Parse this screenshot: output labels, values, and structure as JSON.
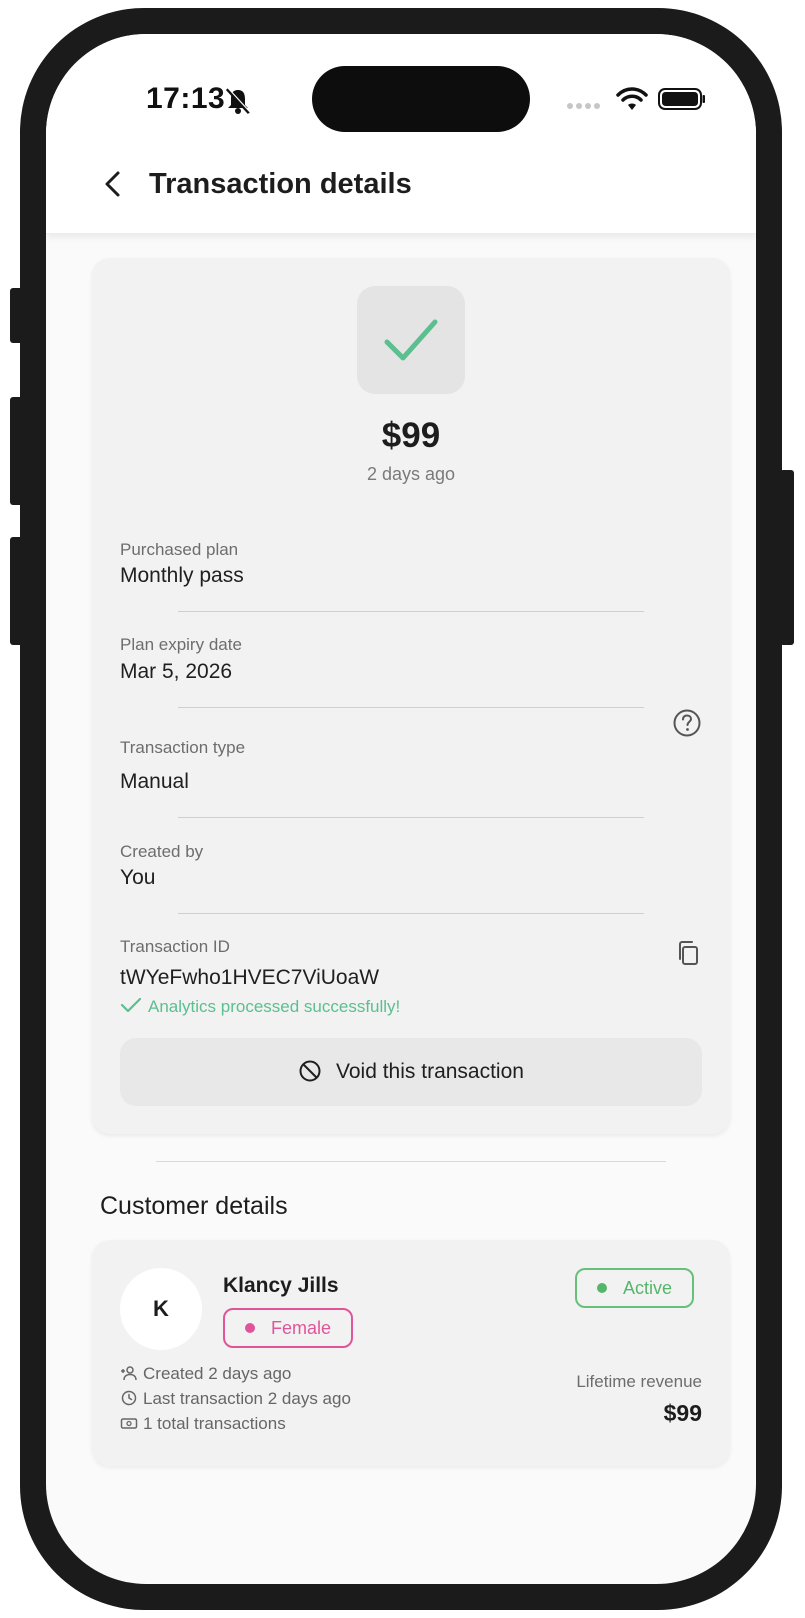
{
  "status_bar": {
    "time": "17:13"
  },
  "header": {
    "title": "Transaction details"
  },
  "transaction": {
    "amount": "$99",
    "ago": "2 days ago",
    "fields": {
      "plan_label": "Purchased plan",
      "plan_value": "Monthly pass",
      "expiry_label": "Plan expiry date",
      "expiry_value": "Mar 5, 2026",
      "type_label": "Transaction type",
      "type_value": "Manual",
      "created_label": "Created by",
      "created_value": "You",
      "id_label": "Transaction ID",
      "id_value": "tWYeFwho1HVEC7ViUoaW"
    },
    "analytics_message": "Analytics processed successfully!",
    "void_label": "Void this transaction"
  },
  "customer": {
    "section_title": "Customer details",
    "initial": "K",
    "name": "Klancy Jills",
    "gender": "Female",
    "status": "Active",
    "created": "Created 2 days ago",
    "last_transaction": "Last transaction 2 days ago",
    "total_transactions": "1 total transactions",
    "revenue_label": "Lifetime revenue",
    "revenue_value": "$99"
  },
  "colors": {
    "success": "#5bbf8f",
    "active": "#56b56c",
    "female": "#e0559a"
  },
  "icons": [
    "bell-slash-icon",
    "back-chevron-icon",
    "check-icon",
    "help-icon",
    "copy-icon",
    "ban-icon",
    "user-add-icon",
    "clock-icon",
    "cash-icon"
  ]
}
